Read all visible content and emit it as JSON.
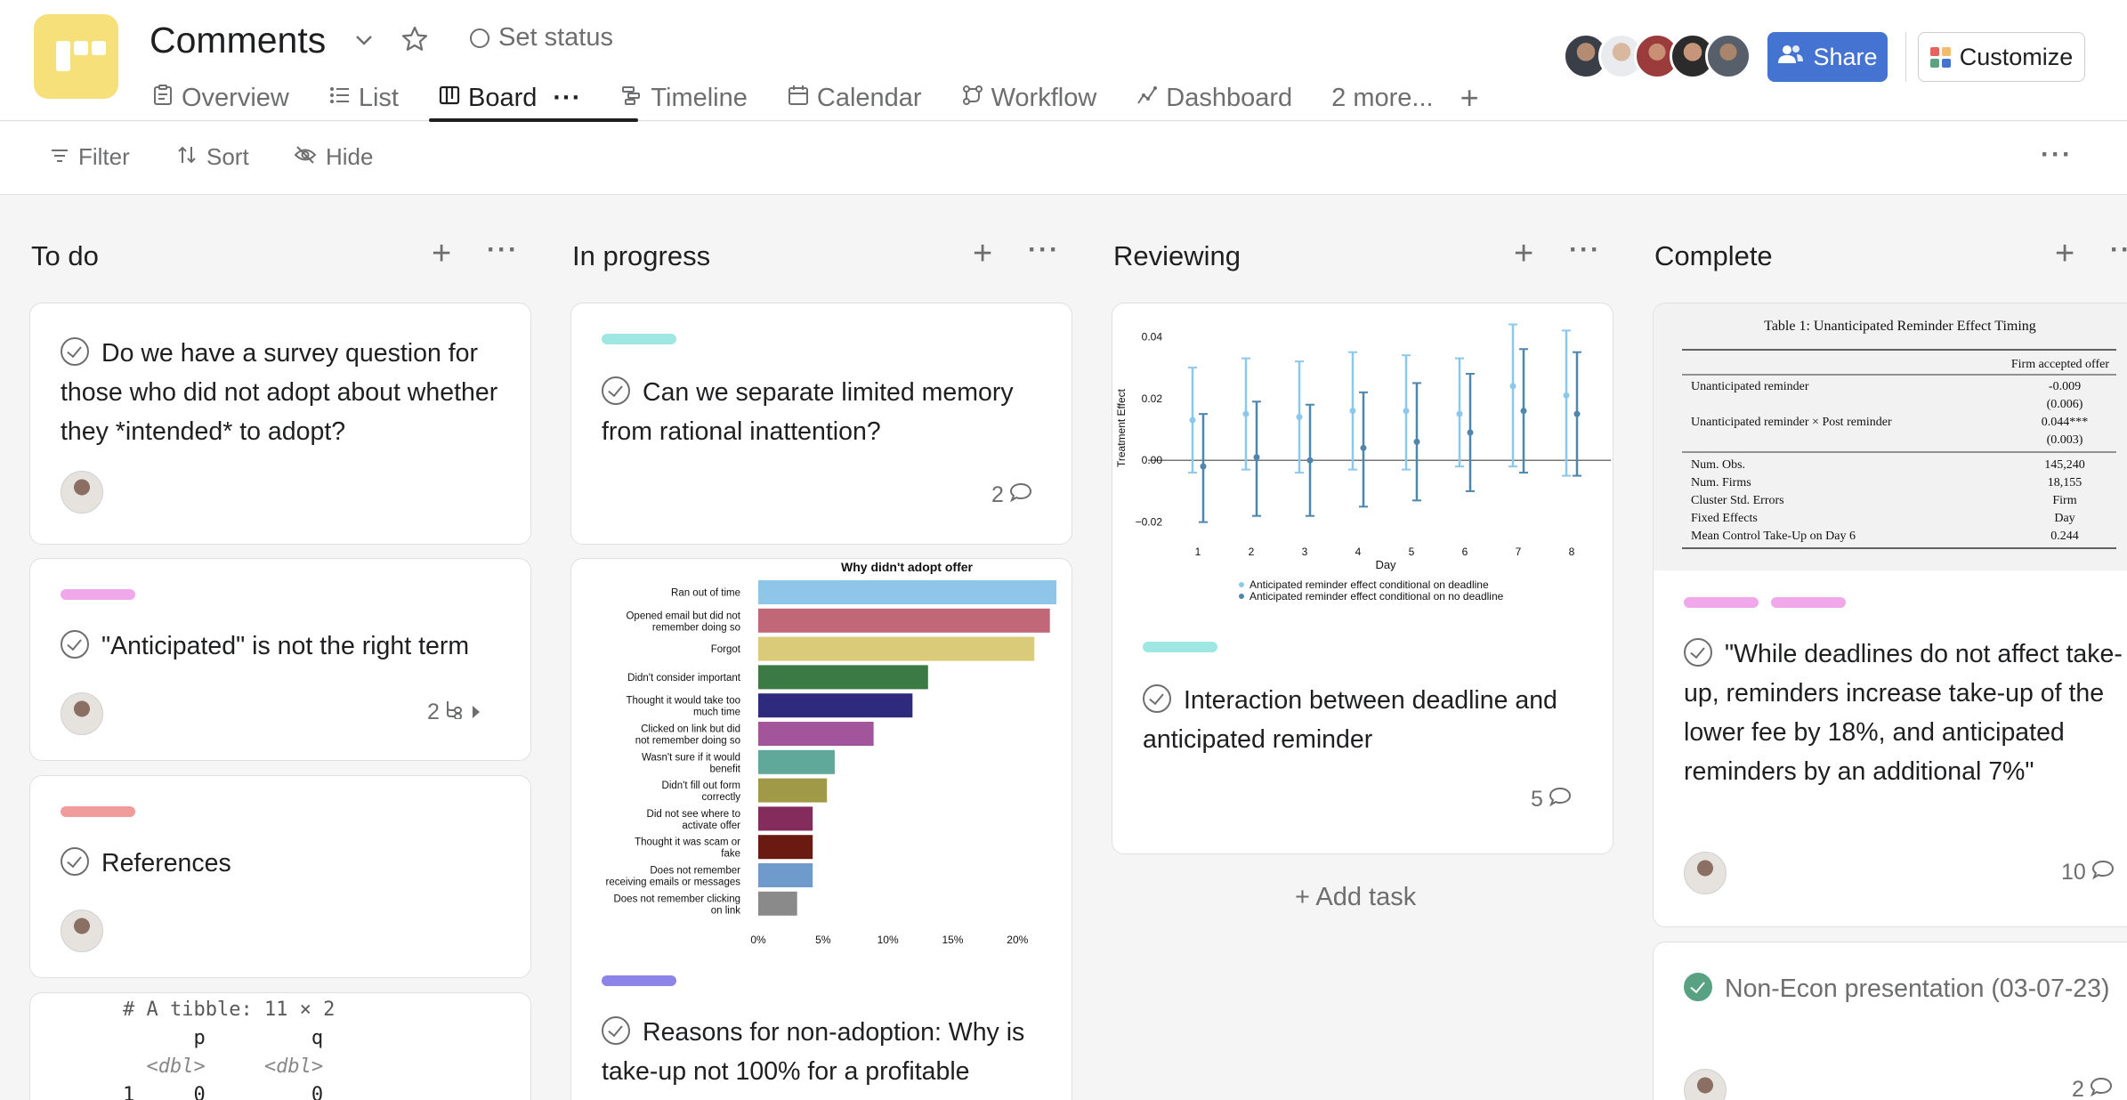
{
  "header": {
    "title": "Comments",
    "set_status": "Set status",
    "share": "Share",
    "customize": "Customize",
    "avatar_colors": [
      "#3a3f47",
      "#cfd2d6",
      "#9b3b3b",
      "#2b2b2b",
      "#57606a"
    ]
  },
  "tabs": [
    {
      "icon": "overview-icon",
      "label": "Overview"
    },
    {
      "icon": "list-icon",
      "label": "List"
    },
    {
      "icon": "board-icon",
      "label": "Board"
    },
    {
      "icon": "timeline-icon",
      "label": "Timeline"
    },
    {
      "icon": "calendar-icon",
      "label": "Calendar"
    },
    {
      "icon": "workflow-icon",
      "label": "Workflow"
    },
    {
      "icon": "dashboard-icon",
      "label": "Dashboard"
    },
    {
      "icon": "",
      "label": "2 more..."
    }
  ],
  "toolbar": {
    "filter": "Filter",
    "sort": "Sort",
    "hide": "Hide"
  },
  "columns": {
    "todo": {
      "name": "To do",
      "cards": [
        {
          "title": "Do we have a survey question for those who did not adopt about whether they *intended* to adopt?"
        },
        {
          "title": "\"Anticipated\" is not the right term",
          "subtasks": "2",
          "tag_color": "#f0a8ea"
        },
        {
          "title": "References",
          "tag_color": "#f19c9c"
        }
      ],
      "code_lines": [
        "# A tibble: 11 × 2",
        "      p         q",
        "  <dbl>     <dbl>",
        "1     0         0"
      ]
    },
    "inprogress": {
      "name": "In progress",
      "cards": [
        {
          "title": "Can we separate limited memory from rational inattention?",
          "comments": "2",
          "tag_color": "#9ee7e3"
        },
        {
          "title": "Reasons for non-adoption: Why is take-up not 100% for a profitable",
          "tag_color": "#8d84e8"
        }
      ]
    },
    "reviewing": {
      "name": "Reviewing",
      "cards": [
        {
          "title": "Interaction between deadline and anticipated reminder",
          "comments": "5",
          "tag_color": "#9ee7e3"
        }
      ],
      "add_task": "+ Add task"
    },
    "complete": {
      "name": "Complete",
      "cards": [
        {
          "title": "\"While deadlines do not affect take-up, reminders increase take-up of the lower fee by 18%, and anticipated reminders by an additional 7%\"",
          "comments": "10",
          "tag_colors": [
            "#f0a8ea",
            "#f0a8ea"
          ]
        },
        {
          "title": "Non-Econ presentation (03-07-23)",
          "comments": "2"
        }
      ]
    }
  },
  "regression_table": {
    "title": "Table 1: Unanticipated Reminder Effect Timing",
    "column": "Firm accepted offer",
    "rows": [
      [
        "Unanticipated reminder",
        "-0.009"
      ],
      [
        "",
        "(0.006)"
      ],
      [
        "Unanticipated reminder × Post reminder",
        "0.044***"
      ],
      [
        "",
        "(0.003)"
      ],
      [
        "Num. Obs.",
        "145,240"
      ],
      [
        "Num. Firms",
        "18,155"
      ],
      [
        "Cluster Std. Errors",
        "Firm"
      ],
      [
        "Fixed Effects",
        "Day"
      ],
      [
        "Mean Control Take-Up on Day 6",
        "0.244"
      ]
    ]
  },
  "chart_data": [
    {
      "type": "bar",
      "title": "Why didn't adopt offer",
      "orientation": "horizontal",
      "categories": [
        "Ran out of time",
        "Opened email but did not remember doing so",
        "Forgot",
        "Didn't consider important",
        "Thought it would take too much time",
        "Clicked on link but did not remember doing so",
        "Wasn't sure if it would benefit",
        "Didn't fill out form correctly",
        "Did not see where to activate offer",
        "Thought it was scam or fake",
        "Does not remember receiving emails or messages",
        "Does not remember clicking on link"
      ],
      "values": [
        23.0,
        22.5,
        21.3,
        13.1,
        11.9,
        8.9,
        5.9,
        5.3,
        4.2,
        4.2,
        4.2,
        3.0
      ],
      "colors": [
        "#8ec5e8",
        "#c06878",
        "#dacb7a",
        "#3b7a44",
        "#2e2a7e",
        "#a3559b",
        "#5fa89a",
        "#a09a48",
        "#842c5c",
        "#6a1a10",
        "#6f9bcc",
        "#8a8a8a"
      ],
      "xlim": [
        0,
        23
      ],
      "xticks": [
        "0%",
        "5%",
        "10%",
        "15%",
        "20%"
      ]
    },
    {
      "type": "scatter",
      "ylabel": "Treatment Effect",
      "xlabel": "Day",
      "x": [
        1,
        2,
        3,
        4,
        5,
        6,
        7,
        8
      ],
      "ylim": [
        -0.025,
        0.045
      ],
      "yticks": [
        "−0.02",
        "0.00",
        "0.02",
        "0.04"
      ],
      "series": [
        {
          "name": "Anticipated reminder effect conditional on deadline",
          "color": "#8cc8ec",
          "values": [
            0.013,
            0.015,
            0.014,
            0.016,
            0.016,
            0.015,
            0.024,
            0.021
          ],
          "lower": [
            -0.004,
            -0.003,
            -0.004,
            -0.003,
            -0.003,
            -0.002,
            -0.002,
            -0.005
          ],
          "upper": [
            0.03,
            0.033,
            0.032,
            0.035,
            0.034,
            0.033,
            0.044,
            0.042
          ]
        },
        {
          "name": "Anticipated reminder effect conditional on no deadline",
          "color": "#4f86ad",
          "values": [
            -0.002,
            0.001,
            0.0,
            0.004,
            0.006,
            0.009,
            0.016,
            0.015
          ],
          "lower": [
            -0.02,
            -0.018,
            -0.018,
            -0.015,
            -0.013,
            -0.01,
            -0.004,
            -0.005
          ],
          "upper": [
            0.015,
            0.019,
            0.018,
            0.022,
            0.025,
            0.028,
            0.036,
            0.035
          ]
        }
      ]
    }
  ]
}
